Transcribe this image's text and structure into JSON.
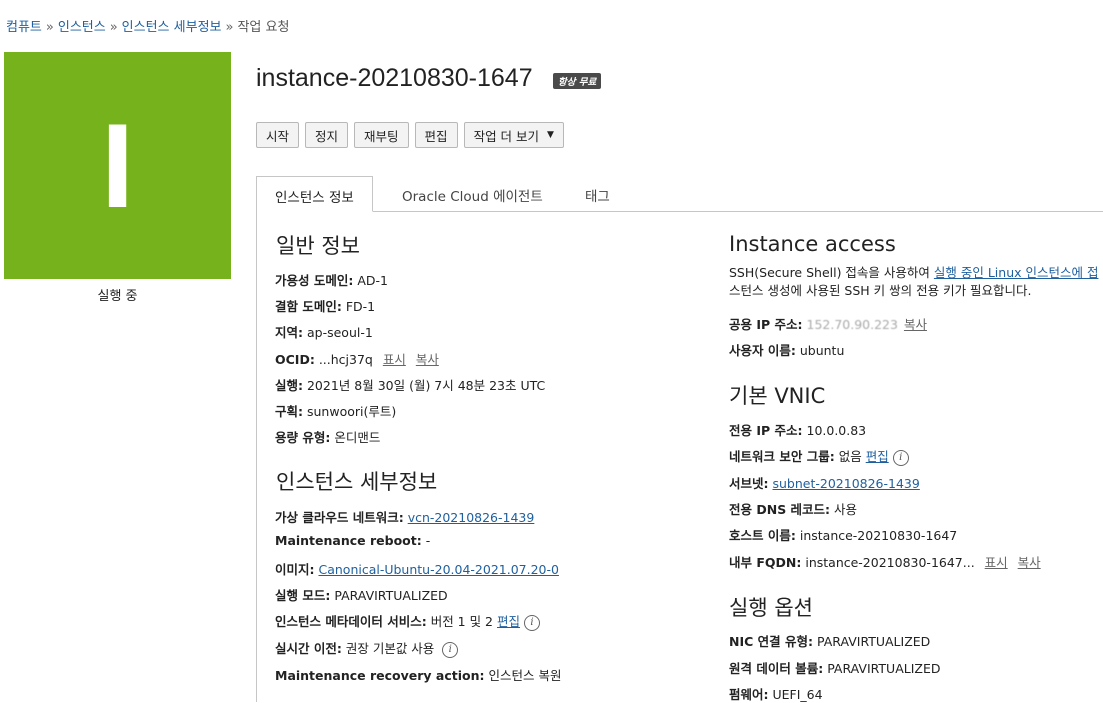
{
  "breadcrumb": {
    "items": [
      "컴퓨트",
      "인스턴스",
      "인스턴스 세부정보"
    ],
    "current": "작업 요청",
    "sep": "»"
  },
  "status": {
    "letter": "I",
    "label": "실행 중",
    "color": "#76b21c"
  },
  "instance": {
    "name": "instance-20210830-1647",
    "badge": "항상 무료"
  },
  "toolbar": {
    "start": "시작",
    "stop": "정지",
    "reboot": "재부팅",
    "edit": "편집",
    "more": "작업 더 보기"
  },
  "tabs": [
    "인스턴스 정보",
    "Oracle Cloud 에이전트",
    "태그"
  ],
  "general": {
    "title": "일반 정보",
    "ad_k": "가용성 도메인:",
    "ad_v": "AD-1",
    "fd_k": "결함 도메인:",
    "fd_v": "FD-1",
    "region_k": "지역:",
    "region_v": "ap-seoul-1",
    "ocid_k": "OCID:",
    "ocid_v": "...hcj37q",
    "ocid_show": "표시",
    "ocid_copy": "복사",
    "launched_k": "실행:",
    "launched_v": "2021년 8월 30일 (월) 7시 48분 23초 UTC",
    "compartment_k": "구획:",
    "compartment_v": "sunwoori(루트)",
    "capacity_k": "용량 유형:",
    "capacity_v": "온디맨드"
  },
  "details": {
    "title": "인스턴스 세부정보",
    "vcn_k": "가상 클라우드 네트워크:",
    "vcn_v": "vcn-20210826-1439",
    "mreboot_k": "Maintenance reboot:",
    "mreboot_v": "-",
    "image_k": "이미지:",
    "image_v": "Canonical-Ubuntu-20.04-2021.07.20-0",
    "mode_k": "실행 모드:",
    "mode_v": "PARAVIRTUALIZED",
    "metadata_k": "인스턴스 메타데이터 서비스:",
    "metadata_v": "버전 1 및 2",
    "metadata_edit": "편집",
    "migration_k": "실시간 이전:",
    "migration_v": "권장 기본값 사용",
    "recovery_k": "Maintenance recovery action:",
    "recovery_v": "인스턴스 복원"
  },
  "access": {
    "title": "Instance access",
    "desc_pre": "SSH(Secure Shell) 접속을 사용하여 ",
    "desc_link": "실행 중인 Linux 인스턴스에 접",
    "desc_line2": "스턴스 생성에 사용된 SSH 키 쌍의 전용 키가 필요합니다.",
    "ip_k": "공용 IP 주소:",
    "ip_v": "152.70.90.223",
    "ip_copy": "복사",
    "user_k": "사용자 이름:",
    "user_v": "ubuntu"
  },
  "vnic": {
    "title": "기본 VNIC",
    "pip_k": "전용 IP 주소:",
    "pip_v": "10.0.0.83",
    "nsg_k": "네트워크 보안 그룹:",
    "nsg_v": "없음",
    "nsg_edit": "편집",
    "subnet_k": "서브넷:",
    "subnet_v": "subnet-20210826-1439",
    "dns_k": "전용 DNS 레코드:",
    "dns_v": "사용",
    "host_k": "호스트 이름:",
    "host_v": "instance-20210830-1647",
    "fqdn_k": "내부 FQDN:",
    "fqdn_v": "instance-20210830-1647...",
    "fqdn_show": "표시",
    "fqdn_copy": "복사"
  },
  "launch": {
    "title": "실행 옵션",
    "nic_k": "NIC 연결 유형:",
    "nic_v": "PARAVIRTUALIZED",
    "rvol_k": "원격 데이터 볼륨:",
    "rvol_v": "PARAVIRTUALIZED",
    "fw_k": "펌웨어:",
    "fw_v": "UEFI_64"
  },
  "icons": {
    "info": "i",
    "caret": "▼"
  }
}
